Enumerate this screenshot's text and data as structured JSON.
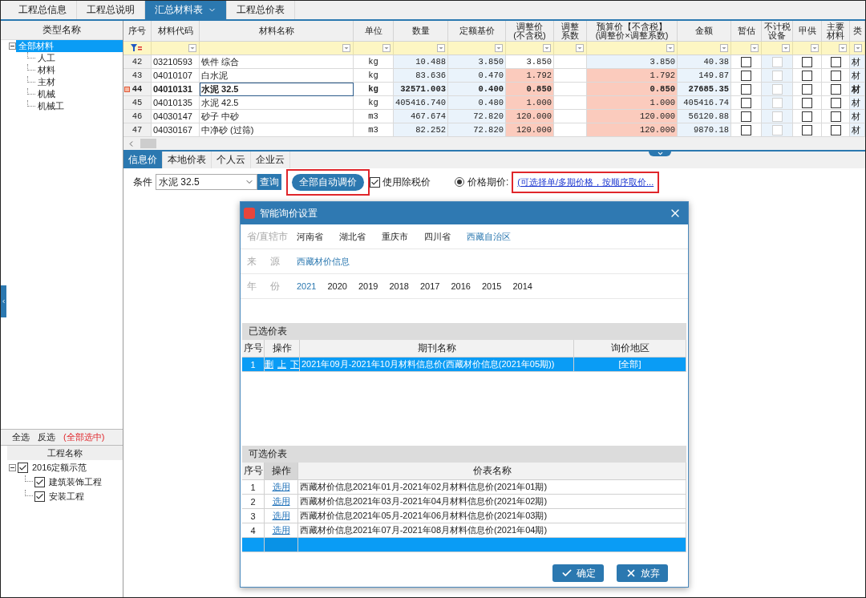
{
  "top_tabs": [
    {
      "label": "工程总信息",
      "selected": false,
      "has_menu": false
    },
    {
      "label": "工程总说明",
      "selected": false,
      "has_menu": false
    },
    {
      "label": "汇总材料表",
      "selected": true,
      "has_menu": true
    },
    {
      "label": "工程总价表",
      "selected": false,
      "has_menu": false
    }
  ],
  "type_tree": {
    "header": "类型名称",
    "root": {
      "label": "全部材料",
      "selected": true,
      "expanded": true,
      "children": [
        {
          "label": "人工",
          "selected": false
        },
        {
          "label": "材料",
          "selected": false
        },
        {
          "label": "主材",
          "selected": false
        },
        {
          "label": "机械",
          "selected": false
        },
        {
          "label": "机械工",
          "selected": false
        }
      ]
    }
  },
  "materials_table": {
    "columns": [
      "序号",
      "材料代码",
      "材料名称",
      "单位",
      "数量",
      "定额基价",
      "调整价\n(不含税)",
      "调整系数",
      "预算价【不含税】\n(调整价×调整系数)",
      "金额",
      "暂估",
      "不计税设备",
      "甲供",
      "主要材料",
      "类"
    ],
    "rows": [
      {
        "index": "42",
        "code": "03210593",
        "name": "铁件 综合",
        "unit": "kg",
        "quantity": "10.488",
        "base_price": "3.850",
        "adjusted_price": "3.850",
        "budget_price": "3.850",
        "amount": "40.38",
        "provisional": false,
        "tax_free_equipment": {
          "checked": false,
          "disabled": true
        },
        "owner_supplied": false,
        "main_material": false,
        "type": "材",
        "adjusted": false,
        "selected": false
      },
      {
        "index": "43",
        "code": "04010107",
        "name": "白水泥",
        "unit": "kg",
        "quantity": "83.636",
        "base_price": "0.470",
        "adjusted_price": "1.792",
        "budget_price": "1.792",
        "amount": "149.87",
        "provisional": false,
        "tax_free_equipment": {
          "checked": false,
          "disabled": true
        },
        "owner_supplied": false,
        "main_material": false,
        "type": "材",
        "adjusted": true,
        "selected": false
      },
      {
        "index": "44",
        "code": "04010131",
        "name": "水泥 32.5",
        "unit": "kg",
        "quantity": "32571.003",
        "base_price": "0.400",
        "adjusted_price": "0.850",
        "budget_price": "0.850",
        "amount": "27685.35",
        "provisional": false,
        "tax_free_equipment": {
          "checked": false,
          "disabled": true
        },
        "owner_supplied": false,
        "main_material": false,
        "type": "材",
        "adjusted": true,
        "selected": true
      },
      {
        "index": "45",
        "code": "04010135",
        "name": "水泥 42.5",
        "unit": "kg",
        "quantity": "405416.740",
        "base_price": "0.480",
        "adjusted_price": "1.000",
        "budget_price": "1.000",
        "amount": "405416.74",
        "provisional": false,
        "tax_free_equipment": {
          "checked": false,
          "disabled": true
        },
        "owner_supplied": false,
        "main_material": false,
        "type": "材",
        "adjusted": true,
        "selected": false
      },
      {
        "index": "46",
        "code": "04030147",
        "name": "砂子 中砂",
        "unit": "m3",
        "quantity": "467.674",
        "base_price": "72.820",
        "adjusted_price": "120.000",
        "budget_price": "120.000",
        "amount": "56120.88",
        "provisional": false,
        "tax_free_equipment": {
          "checked": false,
          "disabled": true
        },
        "owner_supplied": false,
        "main_material": false,
        "type": "材",
        "adjusted": true,
        "selected": false
      },
      {
        "index": "47",
        "code": "04030167",
        "name": "中净砂 (过筛)",
        "unit": "m3",
        "quantity": "82.252",
        "base_price": "72.820",
        "adjusted_price": "120.000",
        "budget_price": "120.000",
        "amount": "9870.18",
        "provisional": false,
        "tax_free_equipment": {
          "checked": false,
          "disabled": true
        },
        "owner_supplied": false,
        "main_material": false,
        "type": "材",
        "adjusted": true,
        "selected": false
      }
    ]
  },
  "price_source_tabs": [
    {
      "label": "信息价",
      "selected": true
    },
    {
      "label": "本地价表",
      "selected": false
    },
    {
      "label": "个人云",
      "selected": false
    },
    {
      "label": "企业云",
      "selected": false
    }
  ],
  "query_bar": {
    "condition_label": "条件",
    "condition_value": "水泥 32.5",
    "query_button": "查询",
    "auto_adjust_button": {
      "label": "全部自动调价",
      "highlighted": true
    },
    "use_tax_excluded": {
      "label": "使用除税价",
      "checked": true
    },
    "price_period": {
      "label": "价格期价:",
      "selected": true
    },
    "period_link": {
      "label": "(可选择单/多期价格，按顺序取价...",
      "highlighted": true
    }
  },
  "project_panel": {
    "select_all": "全选",
    "invert": "反选",
    "status": "(全部选中)",
    "header": "工程名称",
    "root": {
      "label": "2016定额示范",
      "checked": true,
      "expanded": true,
      "children": [
        {
          "label": "建筑装饰工程",
          "checked": true
        },
        {
          "label": "安装工程",
          "checked": true
        }
      ]
    }
  },
  "dialog": {
    "title": "智能询价设置",
    "filters": [
      {
        "label": "省/直辖市",
        "options": [
          {
            "label": "河南省",
            "selected": false
          },
          {
            "label": "湖北省",
            "selected": false
          },
          {
            "label": "重庆市",
            "selected": false
          },
          {
            "label": "四川省",
            "selected": false
          },
          {
            "label": "西藏自治区",
            "selected": true
          }
        ]
      },
      {
        "label": "来 源",
        "options": [
          {
            "label": "西藏材价信息",
            "selected": true
          }
        ]
      },
      {
        "label": "年 份",
        "options": [
          {
            "label": "2021",
            "selected": true
          },
          {
            "label": "2020",
            "selected": false
          },
          {
            "label": "2019",
            "selected": false
          },
          {
            "label": "2018",
            "selected": false
          },
          {
            "label": "2017",
            "selected": false
          },
          {
            "label": "2016",
            "selected": false
          },
          {
            "label": "2015",
            "selected": false
          },
          {
            "label": "2014",
            "selected": false
          }
        ]
      }
    ],
    "chosen": {
      "title": "已选价表",
      "columns": [
        "序号",
        "操作",
        "期刊名称",
        "询价地区"
      ],
      "rows": [
        {
          "index": "1",
          "actions": [
            "删",
            "上",
            "下"
          ],
          "name": "2021年09月-2021年10月材料信息价(西藏材价信息(2021年05期))",
          "region": "[全部]",
          "selected": true
        }
      ]
    },
    "available": {
      "title": "可选价表",
      "columns": [
        "序号",
        "操作",
        "价表名称"
      ],
      "rows": [
        {
          "index": "1",
          "action": "选用",
          "name": "西藏材价信息2021年01月-2021年02月材料信息价(2021年01期)",
          "selected": false
        },
        {
          "index": "2",
          "action": "选用",
          "name": "西藏材价信息2021年03月-2021年04月材料信息价(2021年02期)",
          "selected": false
        },
        {
          "index": "3",
          "action": "选用",
          "name": "西藏材价信息2021年05月-2021年06月材料信息价(2021年03期)",
          "selected": false
        },
        {
          "index": "4",
          "action": "选用",
          "name": "西藏材价信息2021年07月-2021年08月材料信息价(2021年04期)",
          "selected": false
        }
      ],
      "blank_row": {
        "selected": true
      }
    },
    "buttons": [
      {
        "label": "确定",
        "kind": "confirm"
      },
      {
        "label": "放弃",
        "kind": "cancel"
      }
    ]
  }
}
